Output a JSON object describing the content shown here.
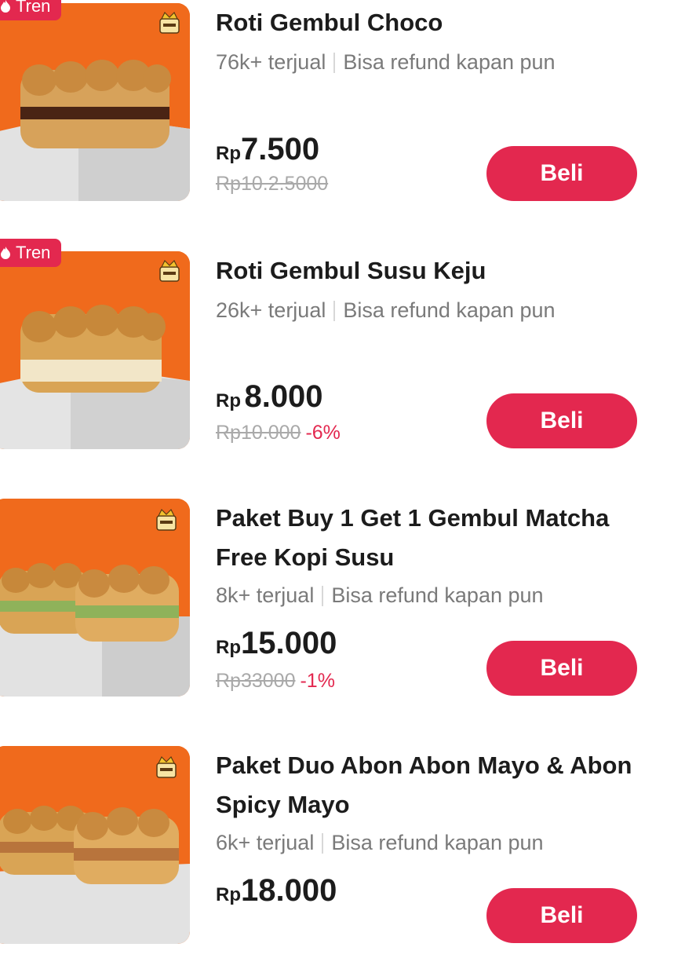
{
  "products": [
    {
      "badge": "Tren",
      "name": "Roti Gembul Choco",
      "sold": "76k+ terjual",
      "refund": "Bisa refund kapan pun",
      "price_currency": "Rp",
      "price_amount": "7.500",
      "old_price": "Rp10.2.5000",
      "discount": "",
      "buy_label": "Beli",
      "bread_filling": "chocolate"
    },
    {
      "badge": "Tren",
      "name": "Roti Gembul Susu Keju",
      "sold": "26k+ terjual",
      "refund": "Bisa refund kapan pun",
      "price_currency": "Rp",
      "price_amount": "8.000",
      "old_price": "Rp10.000",
      "discount": "-6%",
      "buy_label": "Beli",
      "bread_filling": "cheese"
    },
    {
      "badge": "",
      "name": "Paket Buy 1 Get 1 Gembul Matcha Free Kopi Susu",
      "sold": "8k+ terjual",
      "refund": "Bisa refund kapan pun",
      "price_currency": "Rp",
      "price_amount": "15.000",
      "old_price": "Rp33000",
      "discount": "-1%",
      "buy_label": "Beli",
      "bread_filling": "matcha"
    },
    {
      "badge": "",
      "name": "Paket Duo Abon Abon Mayo & Abon Spicy Mayo",
      "sold": "6k+ terjual",
      "refund": "Bisa refund kapan pun",
      "price_currency": "Rp",
      "price_amount": "18.000",
      "old_price": "",
      "discount": "",
      "buy_label": "Beli",
      "bread_filling": "abon"
    }
  ],
  "colors": {
    "accent": "#e3284f",
    "thumb_background": "#f06a1c",
    "muted_text": "#7a7a7a",
    "strike_text": "#a9a9a9"
  }
}
